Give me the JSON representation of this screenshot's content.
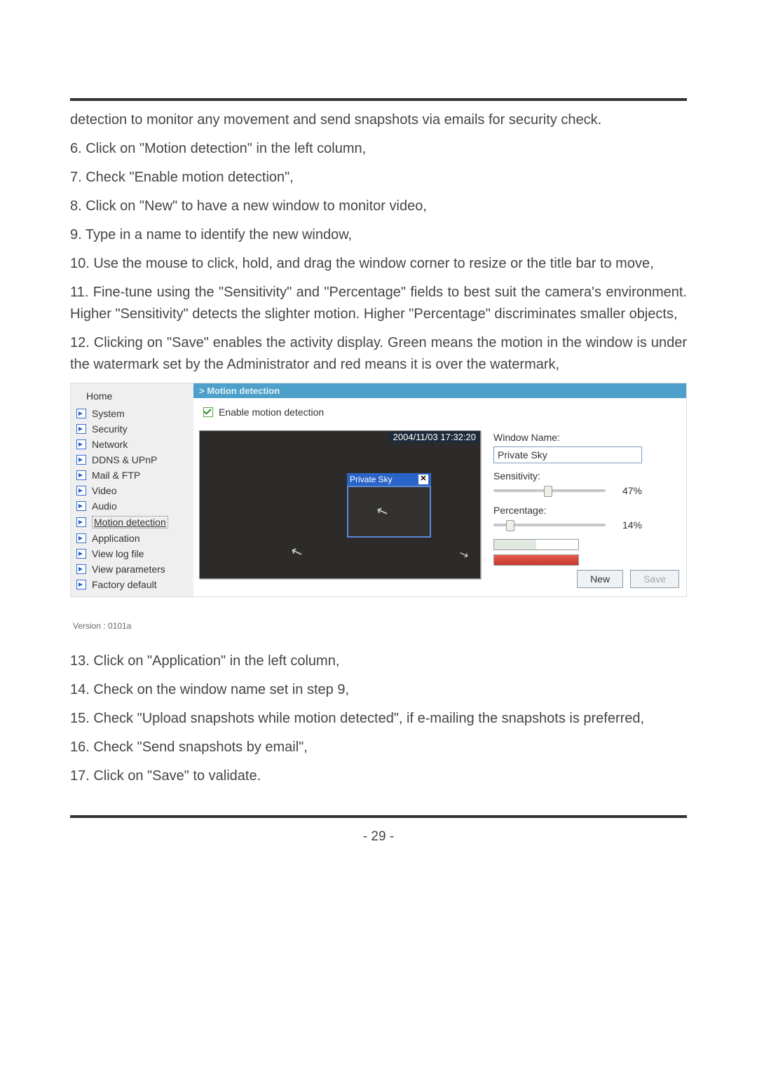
{
  "text_before": [
    "detection to monitor any movement and send snapshots via emails for security check.",
    "6. Click on \"Motion detection\" in the left column,",
    "7. Check \"Enable motion detection\",",
    "8. Click on \"New\" to have a new window to monitor video,",
    "9. Type in a name to identify the new window,",
    "10. Use the mouse to click, hold, and drag the window corner to resize or the title bar to move,",
    "11. Fine-tune using the \"Sensitivity\" and \"Percentage\" fields to best suit the camera's environment. Higher \"Sensitivity\" detects the slighter motion. Higher \"Percentage\" discriminates smaller objects,",
    "12. Clicking on \"Save\" enables the activity display. Green means the motion in the window is under the watermark set by the Administrator and red means it is over the watermark,"
  ],
  "sidebar": {
    "home": "Home",
    "items": [
      "System",
      "Security",
      "Network",
      "DDNS & UPnP",
      "Mail & FTP",
      "Video",
      "Audio",
      "Motion detection",
      "Application",
      "View log file",
      "View parameters",
      "Factory default"
    ],
    "active_index": 7,
    "version": "Version : 0101a"
  },
  "panel": {
    "title": "> Motion detection",
    "enable_label": "Enable motion detection",
    "timestamp": "2004/11/03 17:32:20",
    "det_window_title": "Private Sky",
    "window_name_label": "Window Name:",
    "window_name_value": "Private Sky",
    "sensitivity_label": "Sensitivity:",
    "sensitivity_value": "47%",
    "percentage_label": "Percentage:",
    "percentage_value": "14%",
    "new_btn": "New",
    "save_btn": "Save"
  },
  "text_after": [
    "13. Click on \"Application\" in the left column,",
    "14. Check on the window name set in step 9,",
    "15. Check \"Upload snapshots while motion detected\", if e-mailing the snapshots is preferred,",
    "16. Check \"Send snapshots by email\",",
    "17. Click on \"Save\" to validate."
  ],
  "page_number": "- 29 -"
}
